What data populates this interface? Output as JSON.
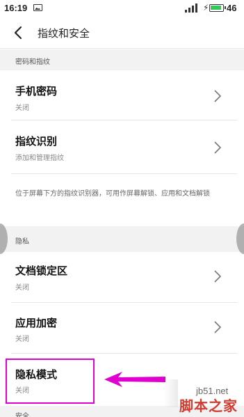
{
  "status_bar": {
    "time": "16:19",
    "battery_level": "46",
    "battery_color": "#34c759"
  },
  "header": {
    "title": "指纹和安全"
  },
  "sections": [
    {
      "label": "密码和指纹"
    },
    {
      "label": "隐私"
    },
    {
      "label": "安全"
    }
  ],
  "items": [
    {
      "title": "手机密码",
      "subtitle": "关闭"
    },
    {
      "title": "指纹识别",
      "subtitle": "添加和管理指纹"
    },
    {
      "title": "文档锁定区",
      "subtitle": "关闭"
    },
    {
      "title": "应用加密",
      "subtitle": "关闭"
    },
    {
      "title": "隐私模式",
      "subtitle": "关闭"
    }
  ],
  "fingerprint_description": "位于屏幕下方的指纹识别器，可用作屏幕解锁、应用和文档解锁",
  "annotation": {
    "highlight_color": "#e000d0"
  },
  "watermark": {
    "domain": "jb51.net",
    "brand": "脚本之家"
  }
}
